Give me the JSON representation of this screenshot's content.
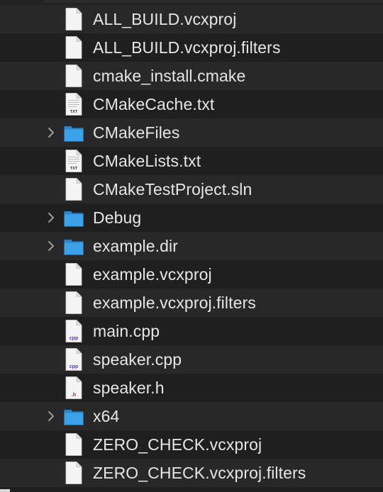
{
  "files": [
    {
      "name": "ALL_BUILD.vcxproj",
      "kind": "doc",
      "tag": "",
      "expandable": false
    },
    {
      "name": "ALL_BUILD.vcxproj.filters",
      "kind": "doc",
      "tag": "",
      "expandable": false
    },
    {
      "name": "cmake_install.cmake",
      "kind": "doc",
      "tag": "",
      "expandable": false
    },
    {
      "name": "CMakeCache.txt",
      "kind": "txt",
      "tag": "TXT",
      "expandable": false
    },
    {
      "name": "CMakeFiles",
      "kind": "folder",
      "tag": "",
      "expandable": true
    },
    {
      "name": "CMakeLists.txt",
      "kind": "txt",
      "tag": "TXT",
      "expandable": false
    },
    {
      "name": "CMakeTestProject.sln",
      "kind": "doc",
      "tag": "",
      "expandable": false
    },
    {
      "name": "Debug",
      "kind": "folder",
      "tag": "",
      "expandable": true
    },
    {
      "name": "example.dir",
      "kind": "folder",
      "tag": "",
      "expandable": true
    },
    {
      "name": "example.vcxproj",
      "kind": "doc",
      "tag": "",
      "expandable": false
    },
    {
      "name": "example.vcxproj.filters",
      "kind": "doc",
      "tag": "",
      "expandable": false
    },
    {
      "name": "main.cpp",
      "kind": "cpp",
      "tag": "cpp",
      "expandable": false
    },
    {
      "name": "speaker.cpp",
      "kind": "cpp",
      "tag": "cpp",
      "expandable": false
    },
    {
      "name": "speaker.h",
      "kind": "h",
      "tag": ".h",
      "expandable": false
    },
    {
      "name": "x64",
      "kind": "folder",
      "tag": "",
      "expandable": true
    },
    {
      "name": "ZERO_CHECK.vcxproj",
      "kind": "doc",
      "tag": "",
      "expandable": false
    },
    {
      "name": "ZERO_CHECK.vcxproj.filters",
      "kind": "doc",
      "tag": "",
      "expandable": false
    }
  ],
  "colors": {
    "background": "#1e1e1e",
    "row_even": "#1f1f1f",
    "row_odd": "#282828",
    "text": "#e6e6e6",
    "folder_blue": "#3ba1e8",
    "folder_blue_dark": "#2b86cf",
    "chevron": "#9a9a9a",
    "doc_white": "#f4f4f4",
    "cpp_tag": "#5a3a9a",
    "h_tag": "#8a2a2a"
  }
}
